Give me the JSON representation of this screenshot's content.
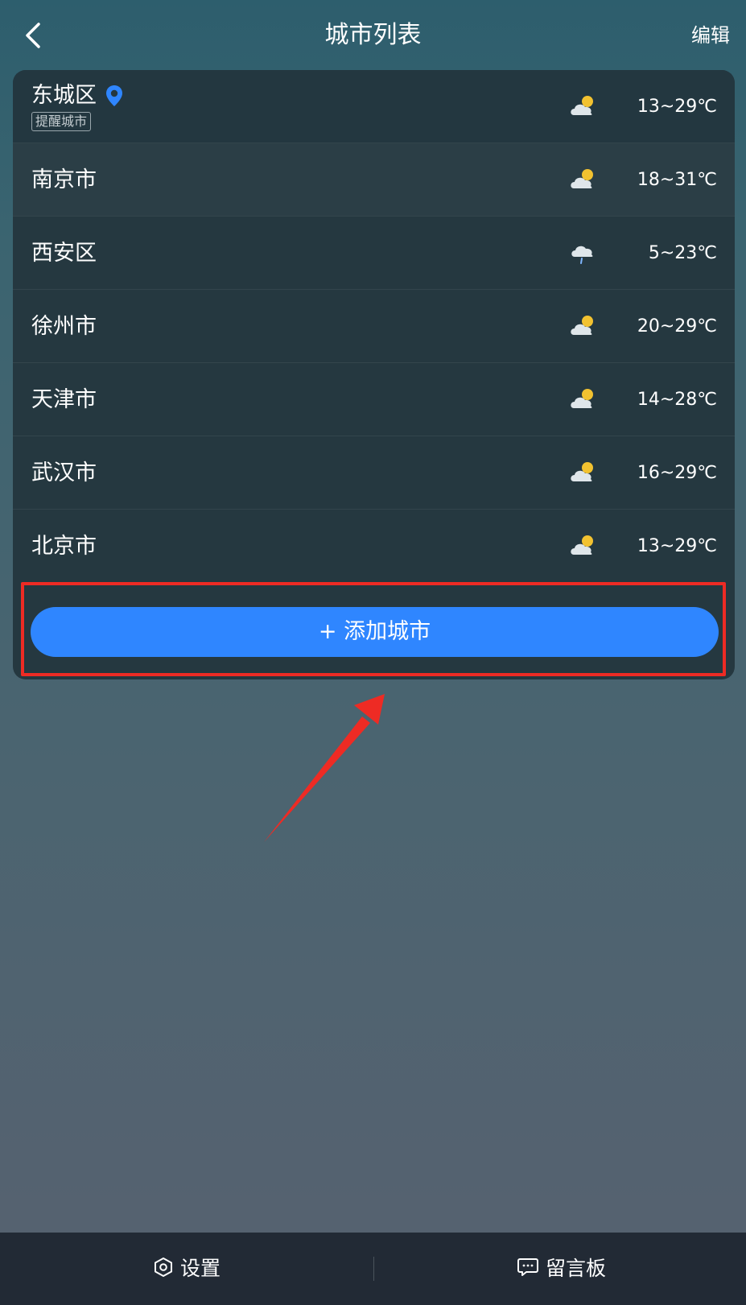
{
  "header": {
    "title": "城市列表",
    "edit_label": "编辑"
  },
  "cities": [
    {
      "name": "东城区",
      "tag": "提醒城市",
      "temp": "13~29℃",
      "icon": "partly-cloudy-icon"
    },
    {
      "name": "南京市",
      "temp": "18~31℃",
      "icon": "partly-cloudy-icon"
    },
    {
      "name": "西安区",
      "temp": "5~23℃",
      "icon": "light-rain-icon"
    },
    {
      "name": "徐州市",
      "temp": "20~29℃",
      "icon": "partly-cloudy-icon"
    },
    {
      "name": "天津市",
      "temp": "14~28℃",
      "icon": "partly-cloudy-icon"
    },
    {
      "name": "武汉市",
      "temp": "16~29℃",
      "icon": "partly-cloudy-icon"
    },
    {
      "name": "北京市",
      "temp": "13~29℃",
      "icon": "partly-cloudy-icon"
    }
  ],
  "add_city_label": "+ 添加城市",
  "bottom_bar": {
    "settings_label": "设置",
    "message_board_label": "留言板"
  },
  "colors": {
    "accent": "#2f86ff",
    "highlight": "#ee2b24",
    "sun": "#f2c230"
  }
}
